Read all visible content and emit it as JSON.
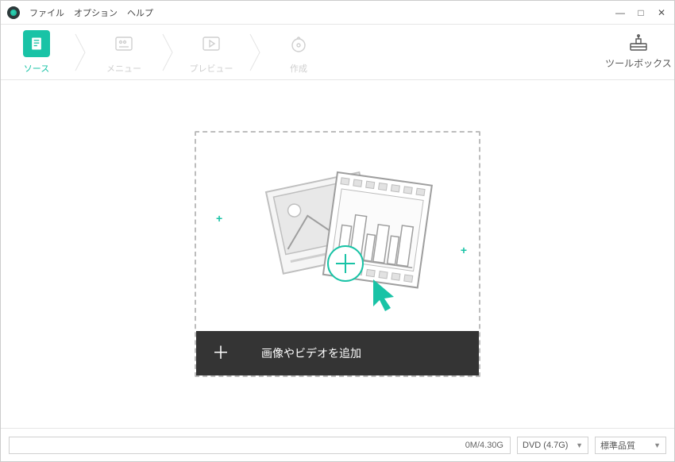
{
  "menu": {
    "file": "ファイル",
    "option": "オプション",
    "help": "ヘルプ"
  },
  "steps": {
    "source": "ソース",
    "menu": "メニュー",
    "preview": "プレビュー",
    "create": "作成"
  },
  "toolbox_label": "ツールボックス",
  "dropzone": {
    "add_label": "画像やビデオを追加"
  },
  "bottom": {
    "size_text": "0M/4.30G",
    "disc_select": "DVD (4.7G)",
    "quality_select": "標準品質"
  }
}
